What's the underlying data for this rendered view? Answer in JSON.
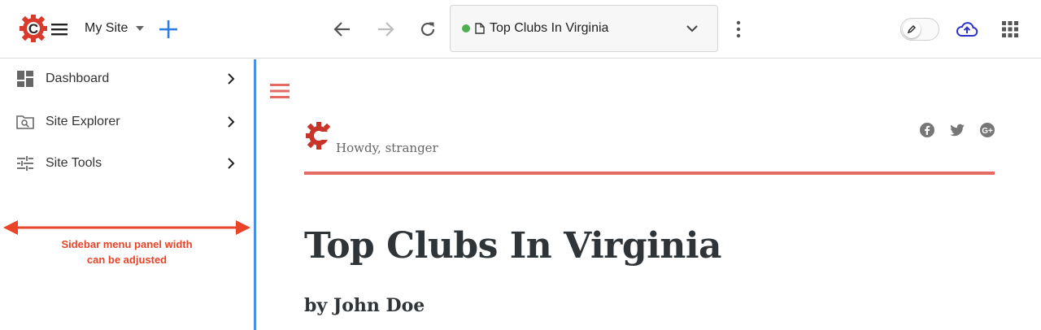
{
  "toolbar": {
    "site_name": "My Site",
    "address_title": "Top Clubs In Virginia",
    "publish_status_color": "#4caf50"
  },
  "sidebar": {
    "items": [
      {
        "label": "Dashboard",
        "icon": "dashboard-icon"
      },
      {
        "label": "Site Explorer",
        "icon": "folder-search-icon"
      },
      {
        "label": "Site Tools",
        "icon": "sliders-icon"
      }
    ],
    "annotation": {
      "line1": "Sidebar menu panel width",
      "line2": "can be adjusted"
    }
  },
  "preview": {
    "greeting": "Howdy, stranger",
    "post_title": "Top Clubs In Virginia",
    "post_author": "by John Doe",
    "social": [
      "facebook-icon",
      "twitter-icon",
      "google-plus-icon"
    ]
  },
  "colors": {
    "accent_blue": "#4a90e2",
    "brand_red": "#d83a2c",
    "preview_accent": "#e46a62",
    "annotation_red": "#e8442a"
  }
}
